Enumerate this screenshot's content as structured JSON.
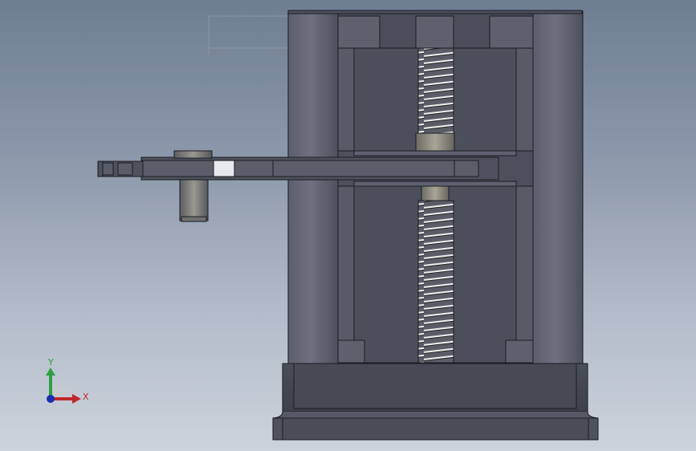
{
  "viewport": {
    "background_top": "#6f7d92",
    "background_bottom": "#cdd3dc",
    "model_body_color": "#4a4e5a",
    "model_edge_color": "#1a1c22"
  },
  "triad": {
    "x_label": "X",
    "y_label": "Y",
    "x_color": "#c0282c",
    "y_color": "#2ea043",
    "z_color": "#1a2fb0"
  }
}
